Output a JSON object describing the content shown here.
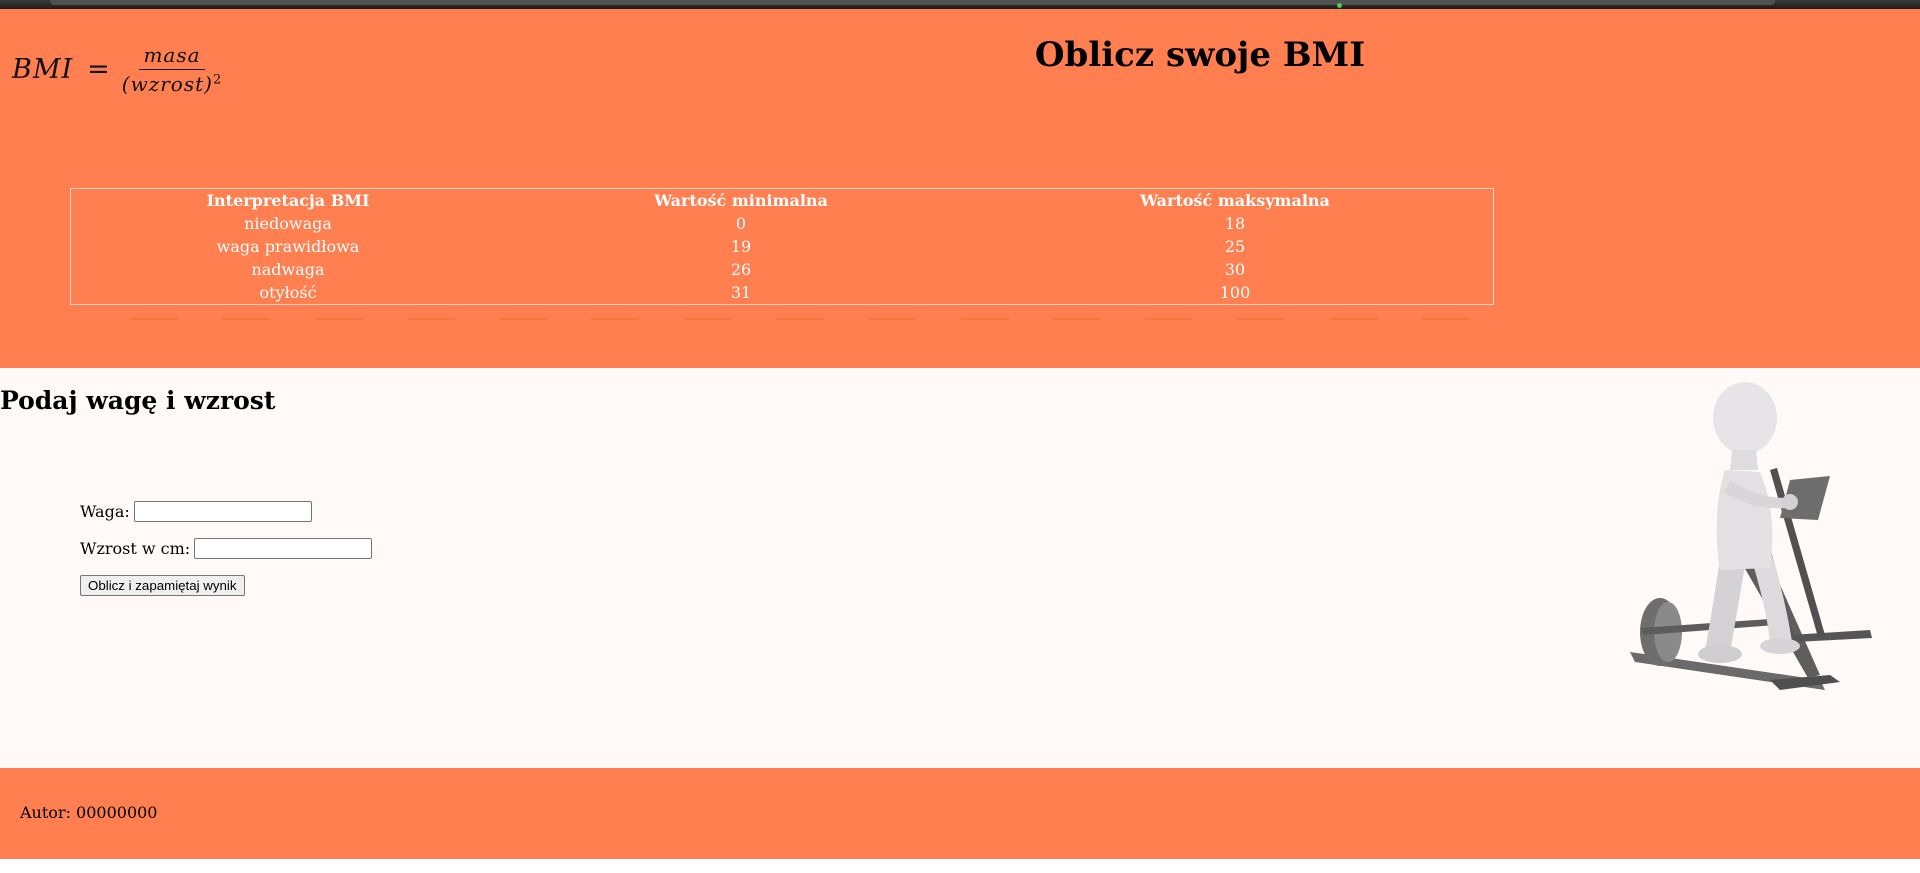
{
  "colors": {
    "header_bg": "#ff7f50",
    "main_bg": "#fffaf7",
    "table_text": "#ffffff"
  },
  "formula": {
    "lhs": "BMI",
    "equals": "=",
    "numerator": "masa",
    "denominator": "(wzrost)",
    "exponent": "2"
  },
  "header": {
    "title": "Oblicz swoje BMI"
  },
  "table": {
    "headers": [
      "Interpretacja BMI",
      "Wartość minimalna",
      "Wartość maksymalna"
    ],
    "rows": [
      [
        "niedowaga",
        "0",
        "18"
      ],
      [
        "waga prawidłowa",
        "19",
        "25"
      ],
      [
        "nadwaga",
        "26",
        "30"
      ],
      [
        "otyłość",
        "31",
        "100"
      ]
    ]
  },
  "form": {
    "heading": "Podaj wagę i wzrost",
    "weight_label": "Waga:",
    "weight_value": "",
    "height_label": "Wzrost w cm:",
    "height_value": "",
    "submit_label": "Oblicz i zapamiętaj wynik"
  },
  "image": {
    "icon": "3d-figure-on-elliptical-trainer"
  },
  "footer": {
    "author": "Autor: 00000000"
  }
}
